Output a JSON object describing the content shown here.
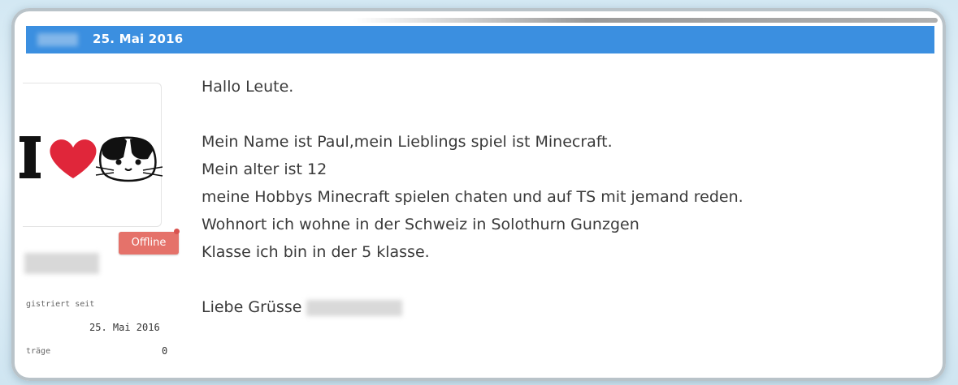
{
  "post": {
    "date": "25. Mai 2016",
    "author": {
      "status": "Offline",
      "registered_label": "gistriert seit",
      "registered_date": "25. Mai 2016",
      "posts_label": "träge",
      "posts_count": "0",
      "avatar_icon": "i-love-guinea-pig-avatar"
    },
    "body": {
      "greeting": "Hallo Leute.",
      "line1": "Mein Name ist Paul,mein Lieblings spiel ist Minecraft.",
      "line2": "Mein alter ist 12",
      "line3": "meine Hobbys Minecraft spielen chaten und auf TS mit jemand reden.",
      "line4": "Wohnort ich wohne in der Schweiz in Solothurn Gunzgen",
      "line5": "Klasse ich bin in der 5 klasse.",
      "closing": "Liebe Grüsse"
    }
  },
  "colors": {
    "header": "#3b8fe0",
    "offline_badge": "#e5726a",
    "heart": "#e0263a"
  }
}
